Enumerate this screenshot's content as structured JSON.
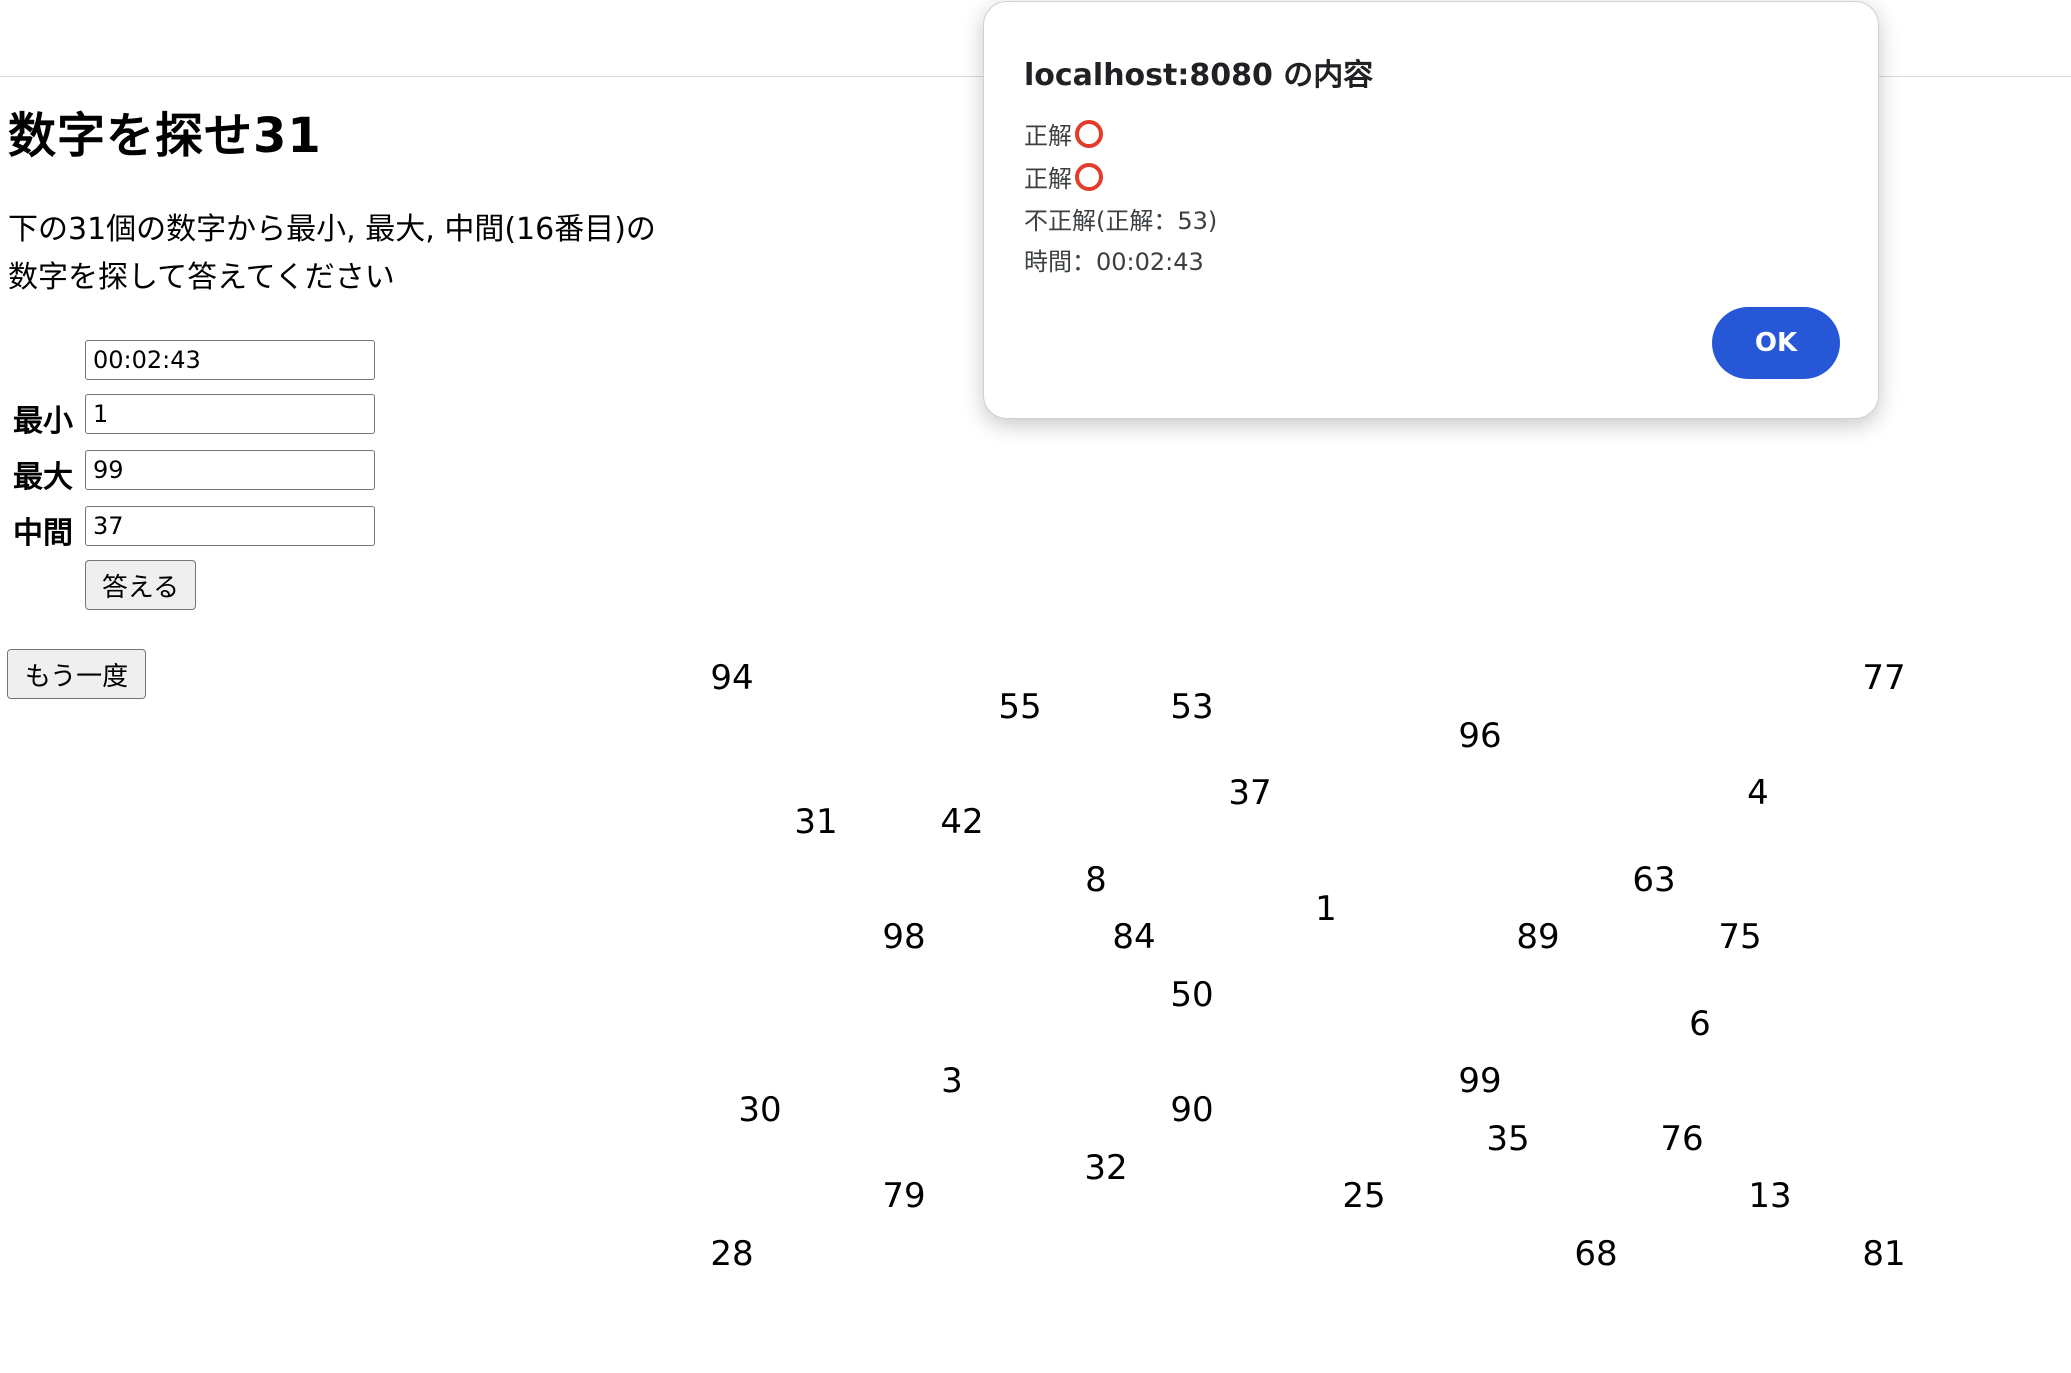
{
  "page": {
    "title": "数字を探せ31",
    "instructions_line1": "下の31個の数字から最小, 最大, 中間(16番目)の",
    "instructions_line2": "数字を探して答えてください"
  },
  "form": {
    "timer_value": "00:02:43",
    "min_label": "最小",
    "min_value": "1",
    "max_label": "最大",
    "max_value": "99",
    "mid_label": "中間",
    "mid_value": "37",
    "answer_button": "答える",
    "retry_button": "もう一度"
  },
  "numbers": [
    {
      "value": "94"
    },
    {
      "value": "55"
    },
    {
      "value": "53"
    },
    {
      "value": "96"
    },
    {
      "value": "77"
    },
    {
      "value": "31"
    },
    {
      "value": "42"
    },
    {
      "value": "37"
    },
    {
      "value": "4"
    },
    {
      "value": "8"
    },
    {
      "value": "1"
    },
    {
      "value": "63"
    },
    {
      "value": "98"
    },
    {
      "value": "84"
    },
    {
      "value": "89"
    },
    {
      "value": "75"
    },
    {
      "value": "50"
    },
    {
      "value": "6"
    },
    {
      "value": "3"
    },
    {
      "value": "99"
    },
    {
      "value": "30"
    },
    {
      "value": "90"
    },
    {
      "value": "35"
    },
    {
      "value": "76"
    },
    {
      "value": "32"
    },
    {
      "value": "79"
    },
    {
      "value": "25"
    },
    {
      "value": "13"
    },
    {
      "value": "28"
    },
    {
      "value": "68"
    },
    {
      "value": "81"
    }
  ],
  "dialog": {
    "title": "localhost:8080 の内容",
    "line1": "正解",
    "line2": "正解",
    "line3": "不正解(正解：53)",
    "line4": "時間：00:02:43",
    "ok_label": "OK",
    "ring_color": "#e23c2c",
    "ok_color": "#2557d6"
  }
}
